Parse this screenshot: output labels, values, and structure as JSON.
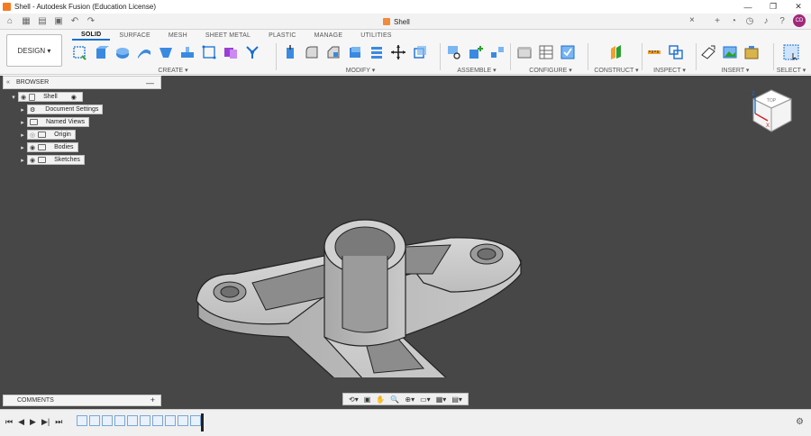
{
  "window": {
    "title": "Shell - Autodesk Fusion (Education License)",
    "minimize_icon": "minimize-icon",
    "maximize_icon": "maximize-icon",
    "close_icon": "close-icon"
  },
  "tabbar": {
    "document_tab": "Shell",
    "user_initials": "CD"
  },
  "toolbar": {
    "workspace": "DESIGN ▾",
    "tabs": [
      "SOLID",
      "SURFACE",
      "MESH",
      "SHEET METAL",
      "PLASTIC",
      "MANAGE",
      "UTILITIES"
    ],
    "active_tab": "SOLID",
    "groups": {
      "create": "CREATE ▾",
      "modify": "MODIFY ▾",
      "assemble": "ASSEMBLE ▾",
      "configure": "CONFIGURE ▾",
      "construct": "CONSTRUCT ▾",
      "inspect": "INSPECT ▾",
      "insert": "INSERT ▾",
      "select": "SELECT ▾"
    }
  },
  "browser": {
    "title": "BROWSER",
    "root": "Shell",
    "items": [
      "Document Settings",
      "Named Views",
      "Origin",
      "Bodies",
      "Sketches"
    ]
  },
  "comments": {
    "title": "COMMENTS"
  },
  "viewcube": {
    "label": "TOP",
    "axis_z": "Z",
    "axis_x": "X"
  }
}
